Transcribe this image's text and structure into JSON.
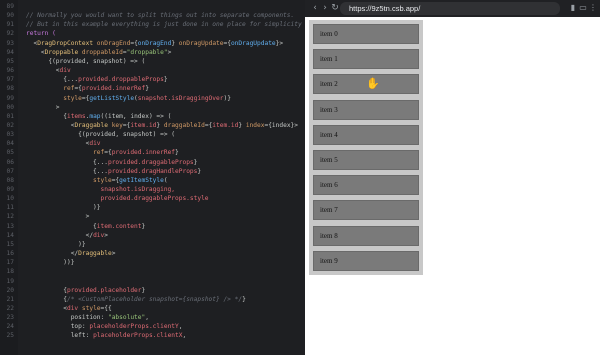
{
  "editor": {
    "lines": [
      {
        "num": "89",
        "segments": [
          {
            "t": "",
            "c": "c-plain"
          }
        ]
      },
      {
        "num": "90",
        "segments": [
          {
            "t": "// Normally you would want to split things out into separate components.",
            "c": "c-comment"
          }
        ]
      },
      {
        "num": "91",
        "segments": [
          {
            "t": "// But in this example everything is just done in one place for simplicity",
            "c": "c-comment"
          }
        ]
      },
      {
        "num": "92",
        "segments": [
          {
            "t": "return (",
            "c": "c-kw"
          }
        ]
      },
      {
        "num": "93",
        "segments": [
          {
            "t": "  <",
            "c": "c-plain"
          },
          {
            "t": "DragDropContext",
            "c": "c-tag"
          },
          {
            "t": " onDragEnd",
            "c": "c-attr"
          },
          {
            "t": "={",
            "c": "c-plain"
          },
          {
            "t": "onDragEnd",
            "c": "c-fn"
          },
          {
            "t": "}",
            "c": "c-plain"
          },
          {
            "t": " onDragUpdate",
            "c": "c-attr"
          },
          {
            "t": "={",
            "c": "c-plain"
          },
          {
            "t": "onDragUpdate",
            "c": "c-fn"
          },
          {
            "t": "}>",
            "c": "c-plain"
          }
        ]
      },
      {
        "num": "94",
        "segments": [
          {
            "t": "    <",
            "c": "c-plain"
          },
          {
            "t": "Droppable",
            "c": "c-tag"
          },
          {
            "t": " droppableId",
            "c": "c-attr"
          },
          {
            "t": "=",
            "c": "c-plain"
          },
          {
            "t": "\"droppable\"",
            "c": "c-str"
          },
          {
            "t": ">",
            "c": "c-plain"
          }
        ]
      },
      {
        "num": "95",
        "segments": [
          {
            "t": "      {(provided, snapshot) => (",
            "c": "c-plain"
          }
        ]
      },
      {
        "num": "96",
        "segments": [
          {
            "t": "        <",
            "c": "c-plain"
          },
          {
            "t": "div",
            "c": "c-var"
          }
        ]
      },
      {
        "num": "97",
        "segments": [
          {
            "t": "          {...",
            "c": "c-plain"
          },
          {
            "t": "provided.droppableProps",
            "c": "c-var"
          },
          {
            "t": "}",
            "c": "c-plain"
          }
        ]
      },
      {
        "num": "98",
        "segments": [
          {
            "t": "          ref",
            "c": "c-attr"
          },
          {
            "t": "={",
            "c": "c-plain"
          },
          {
            "t": "provided.innerRef",
            "c": "c-var"
          },
          {
            "t": "}",
            "c": "c-plain"
          }
        ]
      },
      {
        "num": "99",
        "segments": [
          {
            "t": "          style",
            "c": "c-attr"
          },
          {
            "t": "={",
            "c": "c-plain"
          },
          {
            "t": "getListStyle",
            "c": "c-fn"
          },
          {
            "t": "(",
            "c": "c-plain"
          },
          {
            "t": "snapshot.isDraggingOver",
            "c": "c-var"
          },
          {
            "t": ")}",
            "c": "c-plain"
          }
        ]
      },
      {
        "num": "00",
        "segments": [
          {
            "t": "        >",
            "c": "c-plain"
          }
        ]
      },
      {
        "num": "01",
        "segments": [
          {
            "t": "          {",
            "c": "c-plain"
          },
          {
            "t": "items",
            "c": "c-var"
          },
          {
            "t": ".",
            "c": "c-plain"
          },
          {
            "t": "map",
            "c": "c-fn"
          },
          {
            "t": "((item, index) => (",
            "c": "c-plain"
          }
        ]
      },
      {
        "num": "02",
        "segments": [
          {
            "t": "            <",
            "c": "c-plain"
          },
          {
            "t": "Draggable",
            "c": "c-tag"
          },
          {
            "t": " key",
            "c": "c-attr"
          },
          {
            "t": "={",
            "c": "c-plain"
          },
          {
            "t": "item.id",
            "c": "c-var"
          },
          {
            "t": "}",
            "c": "c-plain"
          },
          {
            "t": " draggableId",
            "c": "c-attr"
          },
          {
            "t": "={",
            "c": "c-plain"
          },
          {
            "t": "item.id",
            "c": "c-var"
          },
          {
            "t": "}",
            "c": "c-plain"
          },
          {
            "t": " index",
            "c": "c-attr"
          },
          {
            "t": "={index}>",
            "c": "c-plain"
          }
        ]
      },
      {
        "num": "03",
        "segments": [
          {
            "t": "              {(provided, snapshot) => (",
            "c": "c-plain"
          }
        ]
      },
      {
        "num": "04",
        "segments": [
          {
            "t": "                <",
            "c": "c-plain"
          },
          {
            "t": "div",
            "c": "c-var"
          }
        ]
      },
      {
        "num": "05",
        "segments": [
          {
            "t": "                  ref",
            "c": "c-attr"
          },
          {
            "t": "={",
            "c": "c-plain"
          },
          {
            "t": "provided.innerRef",
            "c": "c-var"
          },
          {
            "t": "}",
            "c": "c-plain"
          }
        ]
      },
      {
        "num": "06",
        "segments": [
          {
            "t": "                  {...",
            "c": "c-plain"
          },
          {
            "t": "provided.draggableProps",
            "c": "c-var"
          },
          {
            "t": "}",
            "c": "c-plain"
          }
        ]
      },
      {
        "num": "07",
        "segments": [
          {
            "t": "                  {...",
            "c": "c-plain"
          },
          {
            "t": "provided.dragHandleProps",
            "c": "c-var"
          },
          {
            "t": "}",
            "c": "c-plain"
          }
        ]
      },
      {
        "num": "08",
        "segments": [
          {
            "t": "                  style",
            "c": "c-attr"
          },
          {
            "t": "={",
            "c": "c-plain"
          },
          {
            "t": "getItemStyle",
            "c": "c-fn"
          },
          {
            "t": "(",
            "c": "c-plain"
          }
        ]
      },
      {
        "num": "09",
        "segments": [
          {
            "t": "                    snapshot.isDragging,",
            "c": "c-var"
          }
        ]
      },
      {
        "num": "10",
        "segments": [
          {
            "t": "                    provided.draggableProps.style",
            "c": "c-var"
          }
        ]
      },
      {
        "num": "11",
        "segments": [
          {
            "t": "                  )}",
            "c": "c-plain"
          }
        ]
      },
      {
        "num": "12",
        "segments": [
          {
            "t": "                >",
            "c": "c-plain"
          }
        ]
      },
      {
        "num": "13",
        "segments": [
          {
            "t": "                  {",
            "c": "c-plain"
          },
          {
            "t": "item.content",
            "c": "c-var"
          },
          {
            "t": "}",
            "c": "c-plain"
          }
        ]
      },
      {
        "num": "14",
        "segments": [
          {
            "t": "                </",
            "c": "c-plain"
          },
          {
            "t": "div",
            "c": "c-var"
          },
          {
            "t": ">",
            "c": "c-plain"
          }
        ]
      },
      {
        "num": "15",
        "segments": [
          {
            "t": "              )}",
            "c": "c-plain"
          }
        ]
      },
      {
        "num": "16",
        "segments": [
          {
            "t": "            </",
            "c": "c-plain"
          },
          {
            "t": "Draggable",
            "c": "c-tag"
          },
          {
            "t": ">",
            "c": "c-plain"
          }
        ]
      },
      {
        "num": "17",
        "segments": [
          {
            "t": "          ))}",
            "c": "c-plain"
          }
        ]
      },
      {
        "num": "18",
        "segments": [
          {
            "t": "",
            "c": "c-plain"
          }
        ]
      },
      {
        "num": "19",
        "segments": [
          {
            "t": "",
            "c": "c-plain"
          }
        ]
      },
      {
        "num": "20",
        "segments": [
          {
            "t": "          {",
            "c": "c-plain"
          },
          {
            "t": "provided.placeholder",
            "c": "c-var"
          },
          {
            "t": "}",
            "c": "c-plain"
          }
        ]
      },
      {
        "num": "21",
        "segments": [
          {
            "t": "          {",
            "c": "c-plain"
          },
          {
            "t": "/* <CustomPlaceholder snapshot={snapshot} /> */",
            "c": "c-comment"
          },
          {
            "t": "}",
            "c": "c-plain"
          }
        ]
      },
      {
        "num": "22",
        "segments": [
          {
            "t": "          <",
            "c": "c-plain"
          },
          {
            "t": "div",
            "c": "c-var"
          },
          {
            "t": " style",
            "c": "c-attr"
          },
          {
            "t": "={{",
            "c": "c-plain"
          }
        ]
      },
      {
        "num": "23",
        "segments": [
          {
            "t": "            position: ",
            "c": "c-plain"
          },
          {
            "t": "\"absolute\"",
            "c": "c-str"
          },
          {
            "t": ",",
            "c": "c-plain"
          }
        ]
      },
      {
        "num": "24",
        "segments": [
          {
            "t": "            top: ",
            "c": "c-plain"
          },
          {
            "t": "placeholderProps.clientY",
            "c": "c-var"
          },
          {
            "t": ",",
            "c": "c-plain"
          }
        ]
      },
      {
        "num": "25",
        "segments": [
          {
            "t": "            left: ",
            "c": "c-plain"
          },
          {
            "t": "placeholderProps.clientX",
            "c": "c-var"
          },
          {
            "t": ",",
            "c": "c-plain"
          }
        ]
      }
    ]
  },
  "browser": {
    "url": "https://9z5tn.csb.app/",
    "nav": {
      "back": "‹",
      "forward": "›",
      "reload": "↻"
    },
    "icons": [
      "split-view-icon",
      "tab-icon",
      "bookmark-icon",
      "menu-icon"
    ],
    "items": [
      "item 0",
      "item 1",
      "item 2",
      "item 3",
      "item 4",
      "item 5",
      "item 6",
      "item 7",
      "item 8",
      "item 9"
    ],
    "hovered_item": "item 2",
    "colors": {
      "droppable": "#c8c8c8",
      "item": "#7a7a7a"
    }
  }
}
